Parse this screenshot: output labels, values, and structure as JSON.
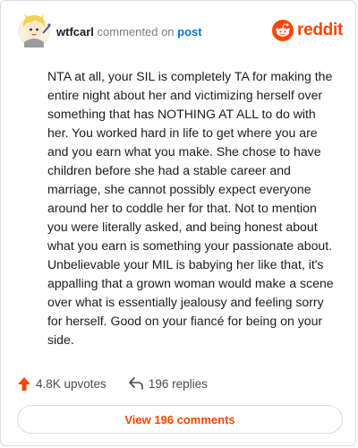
{
  "comment": {
    "username": "wtfcarl",
    "action_text": "commented on",
    "post_link_text": "post",
    "body": "NTA at all, your SIL is completely TA for making the entire night about her and victimizing herself over something that has NOTHING AT ALL to do with her. You worked hard in life to get where you are and you earn what you make. She chose to have children before she had a stable career and marriage, she cannot possibly expect everyone around her to coddle her for that. Not to mention you were literally asked, and being honest about what you earn is something your passionate about. Unbelievable your MIL is babying her like that, it's appalling that a grown woman would make a scene over what is essentially jealousy and feeling sorry for herself. Good on your fiancé for being on your side."
  },
  "brand": {
    "name": "reddit",
    "color": "#ff4500"
  },
  "stats": {
    "upvotes": "4.8K upvotes",
    "replies": "196 replies",
    "upvote_icon": "upvote-arrow-icon",
    "reply_icon": "reply-arrow-icon"
  },
  "actions": {
    "view_comments": "View 196 comments"
  }
}
